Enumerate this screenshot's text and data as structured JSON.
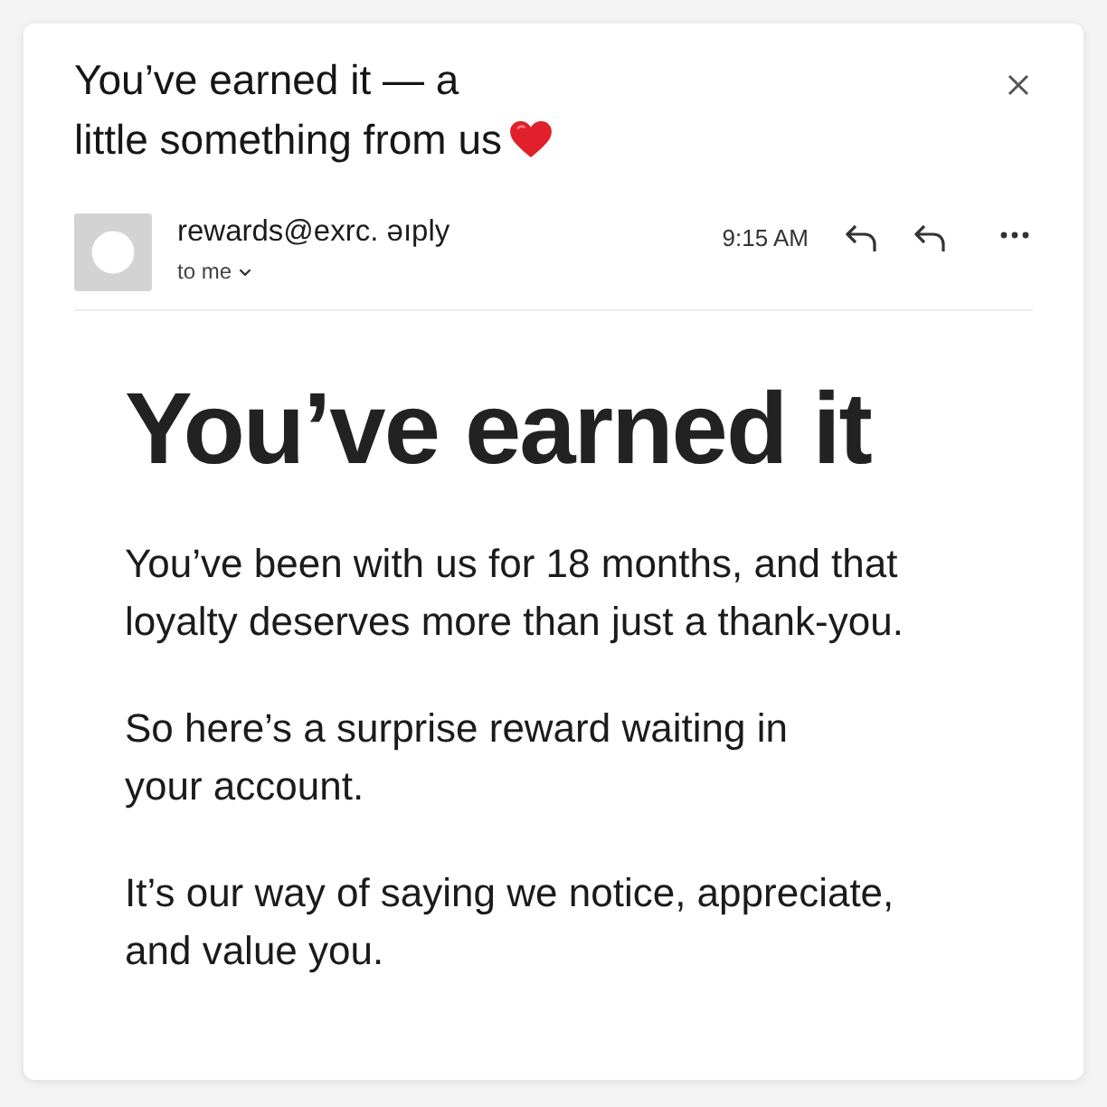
{
  "email": {
    "subject": "You’ve earned it — a\nlittle something from us",
    "sender": {
      "address": "rewards@exrc. əıply",
      "recipient": "to me",
      "time": "9:15 AM"
    },
    "body": {
      "heading": "You’ve earned it",
      "paragraphs": [
        "You’ve been with us for 18 months, and that\nloyalty deserves more than just a thank-you.",
        "So here’s a surprise reward waiting in\nyour account.",
        "It’s our way of saying we notice, appreciate,\nand value you."
      ]
    }
  }
}
